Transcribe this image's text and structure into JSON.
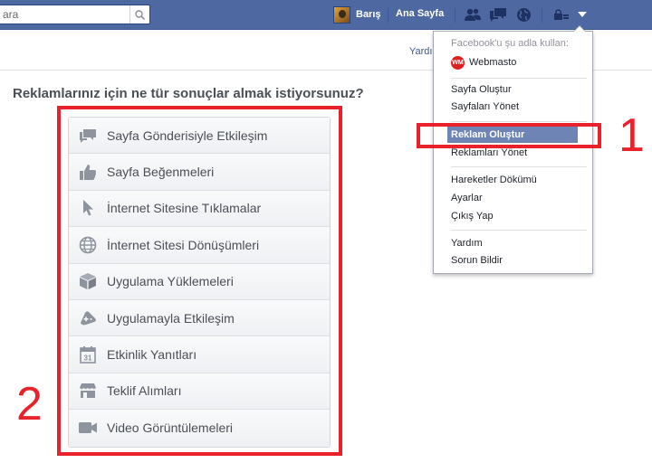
{
  "topbar": {
    "search_placeholder": "ara",
    "profile_name": "Barış",
    "home_label": "Ana Sayfa"
  },
  "subbar": {
    "link": "Yardı"
  },
  "question": "Reklamlarınız için ne tür sonuçlar almak istiyorsunuz?",
  "objectives": [
    {
      "label": "Sayfa Gönderisiyle Etkileşim",
      "icon": "speech-bubbles-icon"
    },
    {
      "label": "Sayfa Beğenmeleri",
      "icon": "thumbs-up-icon"
    },
    {
      "label": "İnternet Sitesine Tıklamalar",
      "icon": "cursor-icon"
    },
    {
      "label": "İnternet Sitesi Dönüşümleri",
      "icon": "globe-icon"
    },
    {
      "label": "Uygulama Yüklemeleri",
      "icon": "box-icon"
    },
    {
      "label": "Uygulamayla Etkileşim",
      "icon": "gamepad-icon"
    },
    {
      "label": "Etkinlik Yanıtları",
      "icon": "calendar-icon"
    },
    {
      "label": "Teklif Alımları",
      "icon": "store-icon"
    },
    {
      "label": "Video Görüntülemeleri",
      "icon": "video-camera-icon"
    }
  ],
  "dropdown": {
    "header": "Facebook'u şu adla kullan:",
    "page_name": "Webmasto",
    "page_logo_text": "WM",
    "items": {
      "create_page": "Sayfa Oluştur",
      "manage_pages": "Sayfaları Yönet",
      "create_ad": "Reklam Oluştur",
      "manage_ads": "Reklamları Yönet",
      "activity_log": "Hareketler Dökümü",
      "settings": "Ayarlar",
      "logout": "Çıkış Yap",
      "help": "Yardım",
      "report": "Sorun Bildir"
    }
  },
  "annotations": {
    "one": "1",
    "two": "2"
  },
  "colors": {
    "topbar": "#4e69a2",
    "selected": "#6d84b4",
    "annotation": "#e8212a"
  }
}
